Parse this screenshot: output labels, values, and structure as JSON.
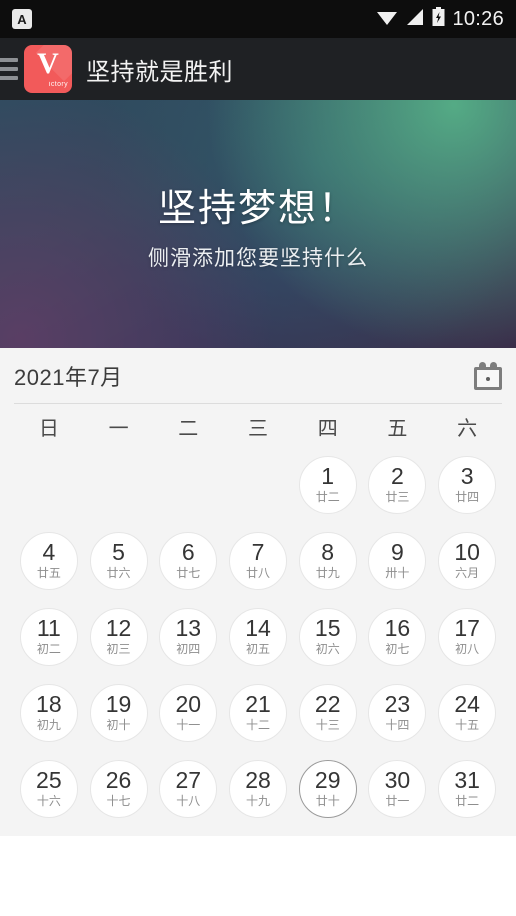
{
  "status_bar": {
    "ime_label": "A",
    "time": "10:26",
    "icons": [
      "wifi-icon",
      "signal-icon",
      "battery-charging-icon"
    ]
  },
  "app_bar": {
    "menu_icon": "hamburger-menu-icon",
    "logo": {
      "letter": "V",
      "wordmark": "ictory",
      "color": "#f25a5a"
    },
    "title": "坚持就是胜利"
  },
  "hero": {
    "title": "坚持梦想！",
    "subtitle": "侧滑添加您要坚持什么",
    "gradient_colors": [
      "#2f4c60",
      "#56b087",
      "#603e66",
      "#3a2f4a"
    ]
  },
  "calendar": {
    "month_label": "2021年7月",
    "icon": "calendar-icon",
    "weekdays": [
      "日",
      "一",
      "二",
      "三",
      "四",
      "五",
      "六"
    ],
    "today": 29,
    "weeks": [
      [
        {
          "num": "",
          "lunar": "",
          "empty": true
        },
        {
          "num": "",
          "lunar": "",
          "empty": true
        },
        {
          "num": "",
          "lunar": "",
          "empty": true
        },
        {
          "num": "",
          "lunar": "",
          "empty": true
        },
        {
          "num": "1",
          "lunar": "廿二"
        },
        {
          "num": "2",
          "lunar": "廿三"
        },
        {
          "num": "3",
          "lunar": "廿四"
        }
      ],
      [
        {
          "num": "4",
          "lunar": "廿五"
        },
        {
          "num": "5",
          "lunar": "廿六"
        },
        {
          "num": "6",
          "lunar": "廿七"
        },
        {
          "num": "7",
          "lunar": "廿八"
        },
        {
          "num": "8",
          "lunar": "廿九"
        },
        {
          "num": "9",
          "lunar": "卅十"
        },
        {
          "num": "10",
          "lunar": "六月"
        }
      ],
      [
        {
          "num": "11",
          "lunar": "初二"
        },
        {
          "num": "12",
          "lunar": "初三"
        },
        {
          "num": "13",
          "lunar": "初四"
        },
        {
          "num": "14",
          "lunar": "初五"
        },
        {
          "num": "15",
          "lunar": "初六"
        },
        {
          "num": "16",
          "lunar": "初七"
        },
        {
          "num": "17",
          "lunar": "初八"
        }
      ],
      [
        {
          "num": "18",
          "lunar": "初九"
        },
        {
          "num": "19",
          "lunar": "初十"
        },
        {
          "num": "20",
          "lunar": "十一"
        },
        {
          "num": "21",
          "lunar": "十二"
        },
        {
          "num": "22",
          "lunar": "十三"
        },
        {
          "num": "23",
          "lunar": "十四"
        },
        {
          "num": "24",
          "lunar": "十五"
        }
      ],
      [
        {
          "num": "25",
          "lunar": "十六"
        },
        {
          "num": "26",
          "lunar": "十七"
        },
        {
          "num": "27",
          "lunar": "十八"
        },
        {
          "num": "28",
          "lunar": "十九"
        },
        {
          "num": "29",
          "lunar": "廿十",
          "today": true
        },
        {
          "num": "30",
          "lunar": "廿一"
        },
        {
          "num": "31",
          "lunar": "廿二"
        }
      ]
    ]
  }
}
